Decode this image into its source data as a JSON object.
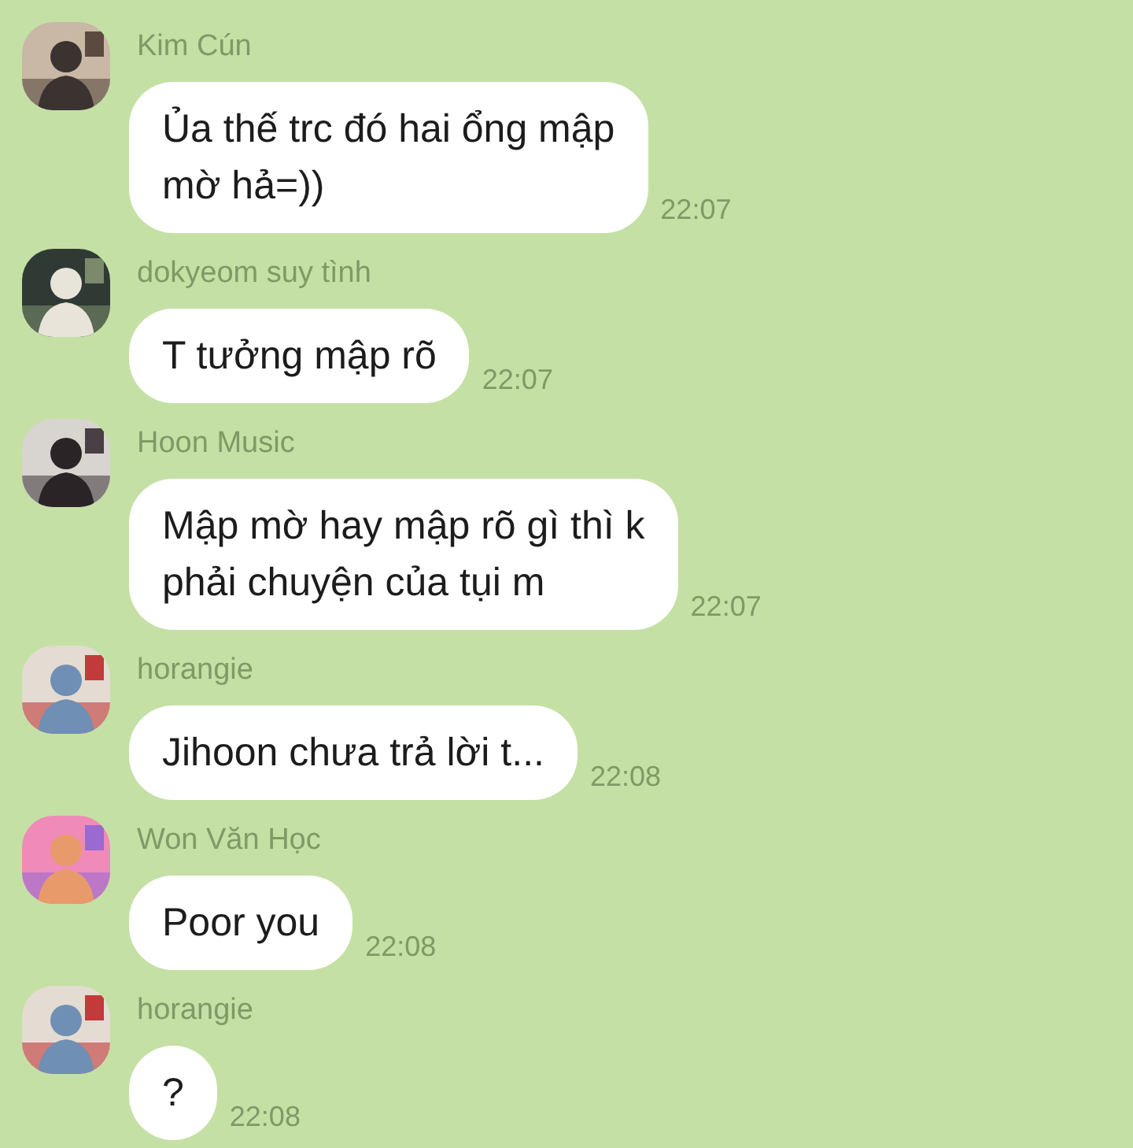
{
  "messages": [
    {
      "sender": "Kim Cún",
      "text": "Ủa thế trc đó hai ổng mập\nmờ hả=))",
      "time": "22:07"
    },
    {
      "sender": "dokyeom suy tình",
      "text": "T tưởng mập rõ",
      "time": "22:07"
    },
    {
      "sender": "Hoon Music",
      "text": "Mập mờ hay mập rõ gì thì k\nphải chuyện của tụi m",
      "time": "22:07"
    },
    {
      "sender": "horangie",
      "text": "Jihoon chưa trả lời t...",
      "time": "22:08"
    },
    {
      "sender": "Won Văn Học",
      "text": "Poor you",
      "time": "22:08"
    },
    {
      "sender": "horangie",
      "text": "?",
      "time": "22:08"
    }
  ]
}
